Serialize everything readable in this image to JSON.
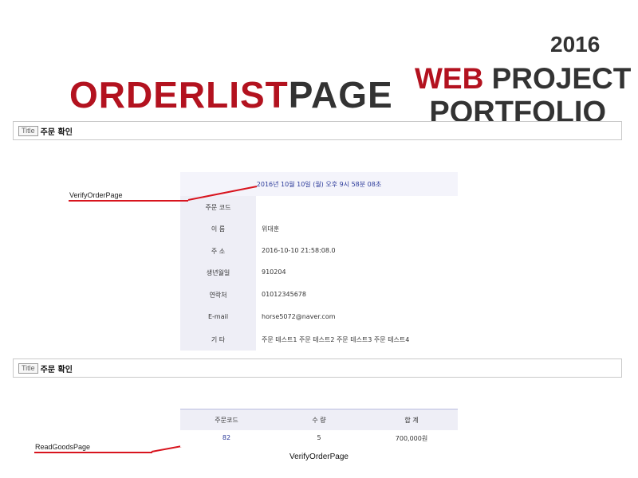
{
  "header": {
    "year": "2016",
    "project_accent": "WEB",
    "project_rest": " PROJECT",
    "portfolio": "PORTFOLIO",
    "page_title_accent": "ORDERLIST",
    "page_title_rest": "PAGE"
  },
  "section1": {
    "tag": "Title",
    "title": "주문 확인"
  },
  "verify_panel": {
    "date": "2016년 10월 10일 (월) 오후 9시 58분 08초",
    "rows": [
      {
        "label": "주문 코드",
        "value": ""
      },
      {
        "label": "이 름",
        "value": "위대훈"
      },
      {
        "label": "주 소",
        "value": "2016-10-10 21:58:08.0"
      },
      {
        "label": "생년월일",
        "value": "910204"
      },
      {
        "label": "연락처",
        "value": "01012345678"
      },
      {
        "label": "E-mail",
        "value": "horse5072@naver.com"
      },
      {
        "label": "기 타",
        "value": "주문 테스트1 주문 테스트2 주문 테스트3 주문 테스트4"
      }
    ]
  },
  "callouts": {
    "verify": "VerifyOrderPage",
    "read_goods": "ReadGoodsPage"
  },
  "section2": {
    "tag": "Title",
    "title": "주문 확인"
  },
  "order_table": {
    "headers": [
      "주문코드",
      "수 량",
      "합 계"
    ],
    "rows": [
      {
        "code": "82",
        "qty": "5",
        "total": "700,000원"
      }
    ]
  },
  "footer": {
    "label": "VerifyOrderPage"
  },
  "colors": {
    "accent": "#b3121f",
    "link": "#2b3a9a",
    "callout_line": "#d8141e"
  }
}
